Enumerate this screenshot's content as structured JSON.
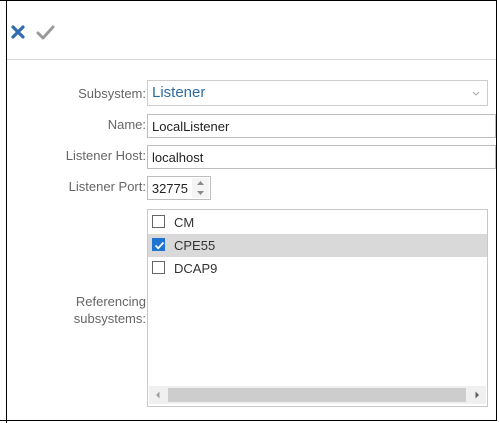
{
  "toolbar": {
    "cancel_icon": "close-icon",
    "save_icon": "checkmark-icon",
    "cancel_color": "#2f6db0",
    "save_color": "#9a9a9a"
  },
  "form": {
    "subsystem_label": "Subsystem:",
    "subsystem_value": "Listener",
    "name_label": "Name:",
    "name_value": "LocalListener",
    "host_label": "Listener Host:",
    "host_value": "localhost",
    "port_label": "Listener Port:",
    "port_value": "32775",
    "ref_label_line1": "Referencing",
    "ref_label_line2": "subsystems:"
  },
  "referencing": {
    "items": [
      {
        "label": "CM",
        "checked": false,
        "selected": false
      },
      {
        "label": "CPE55",
        "checked": true,
        "selected": true
      },
      {
        "label": "DCAP9",
        "checked": false,
        "selected": false
      }
    ]
  },
  "colors": {
    "accent": "#2d6ca2",
    "checkbox_checked": "#1f73d1",
    "row_selected": "#d9d9d9"
  }
}
